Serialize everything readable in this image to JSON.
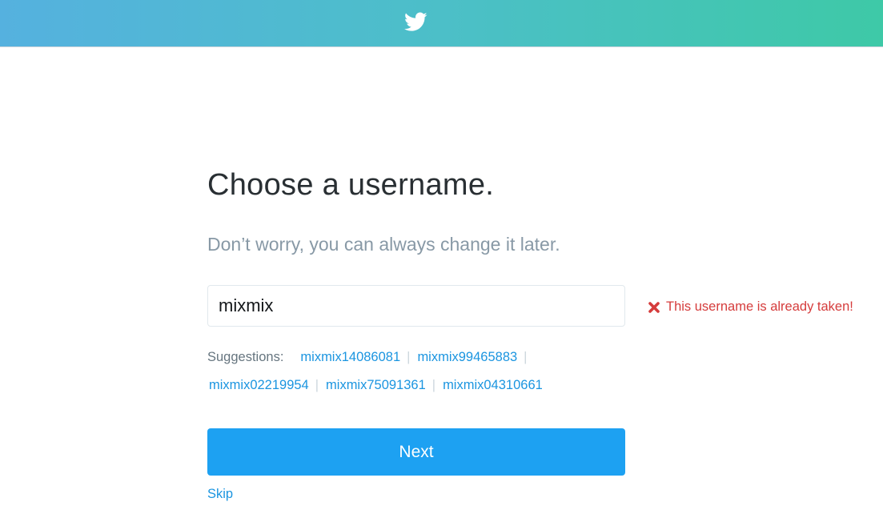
{
  "header": {
    "logo_icon": "twitter-bird-icon",
    "gradient_start": "#55b1df",
    "gradient_end": "#3ec9a7"
  },
  "main": {
    "title": "Choose a username.",
    "subtitle": "Don’t worry, you can always change it later.",
    "username_value": "mixmix",
    "error": {
      "icon": "x-icon",
      "text": "This username is already taken!",
      "color": "#d53c3c"
    },
    "suggestions_label": "Suggestions:",
    "suggestions": [
      "mixmix14086081",
      "mixmix99465883",
      "mixmix02219954",
      "mixmix75091361",
      "mixmix04310661"
    ],
    "separator": "|",
    "next_label": "Next",
    "skip_label": "Skip",
    "accent_color": "#1da1f2"
  }
}
